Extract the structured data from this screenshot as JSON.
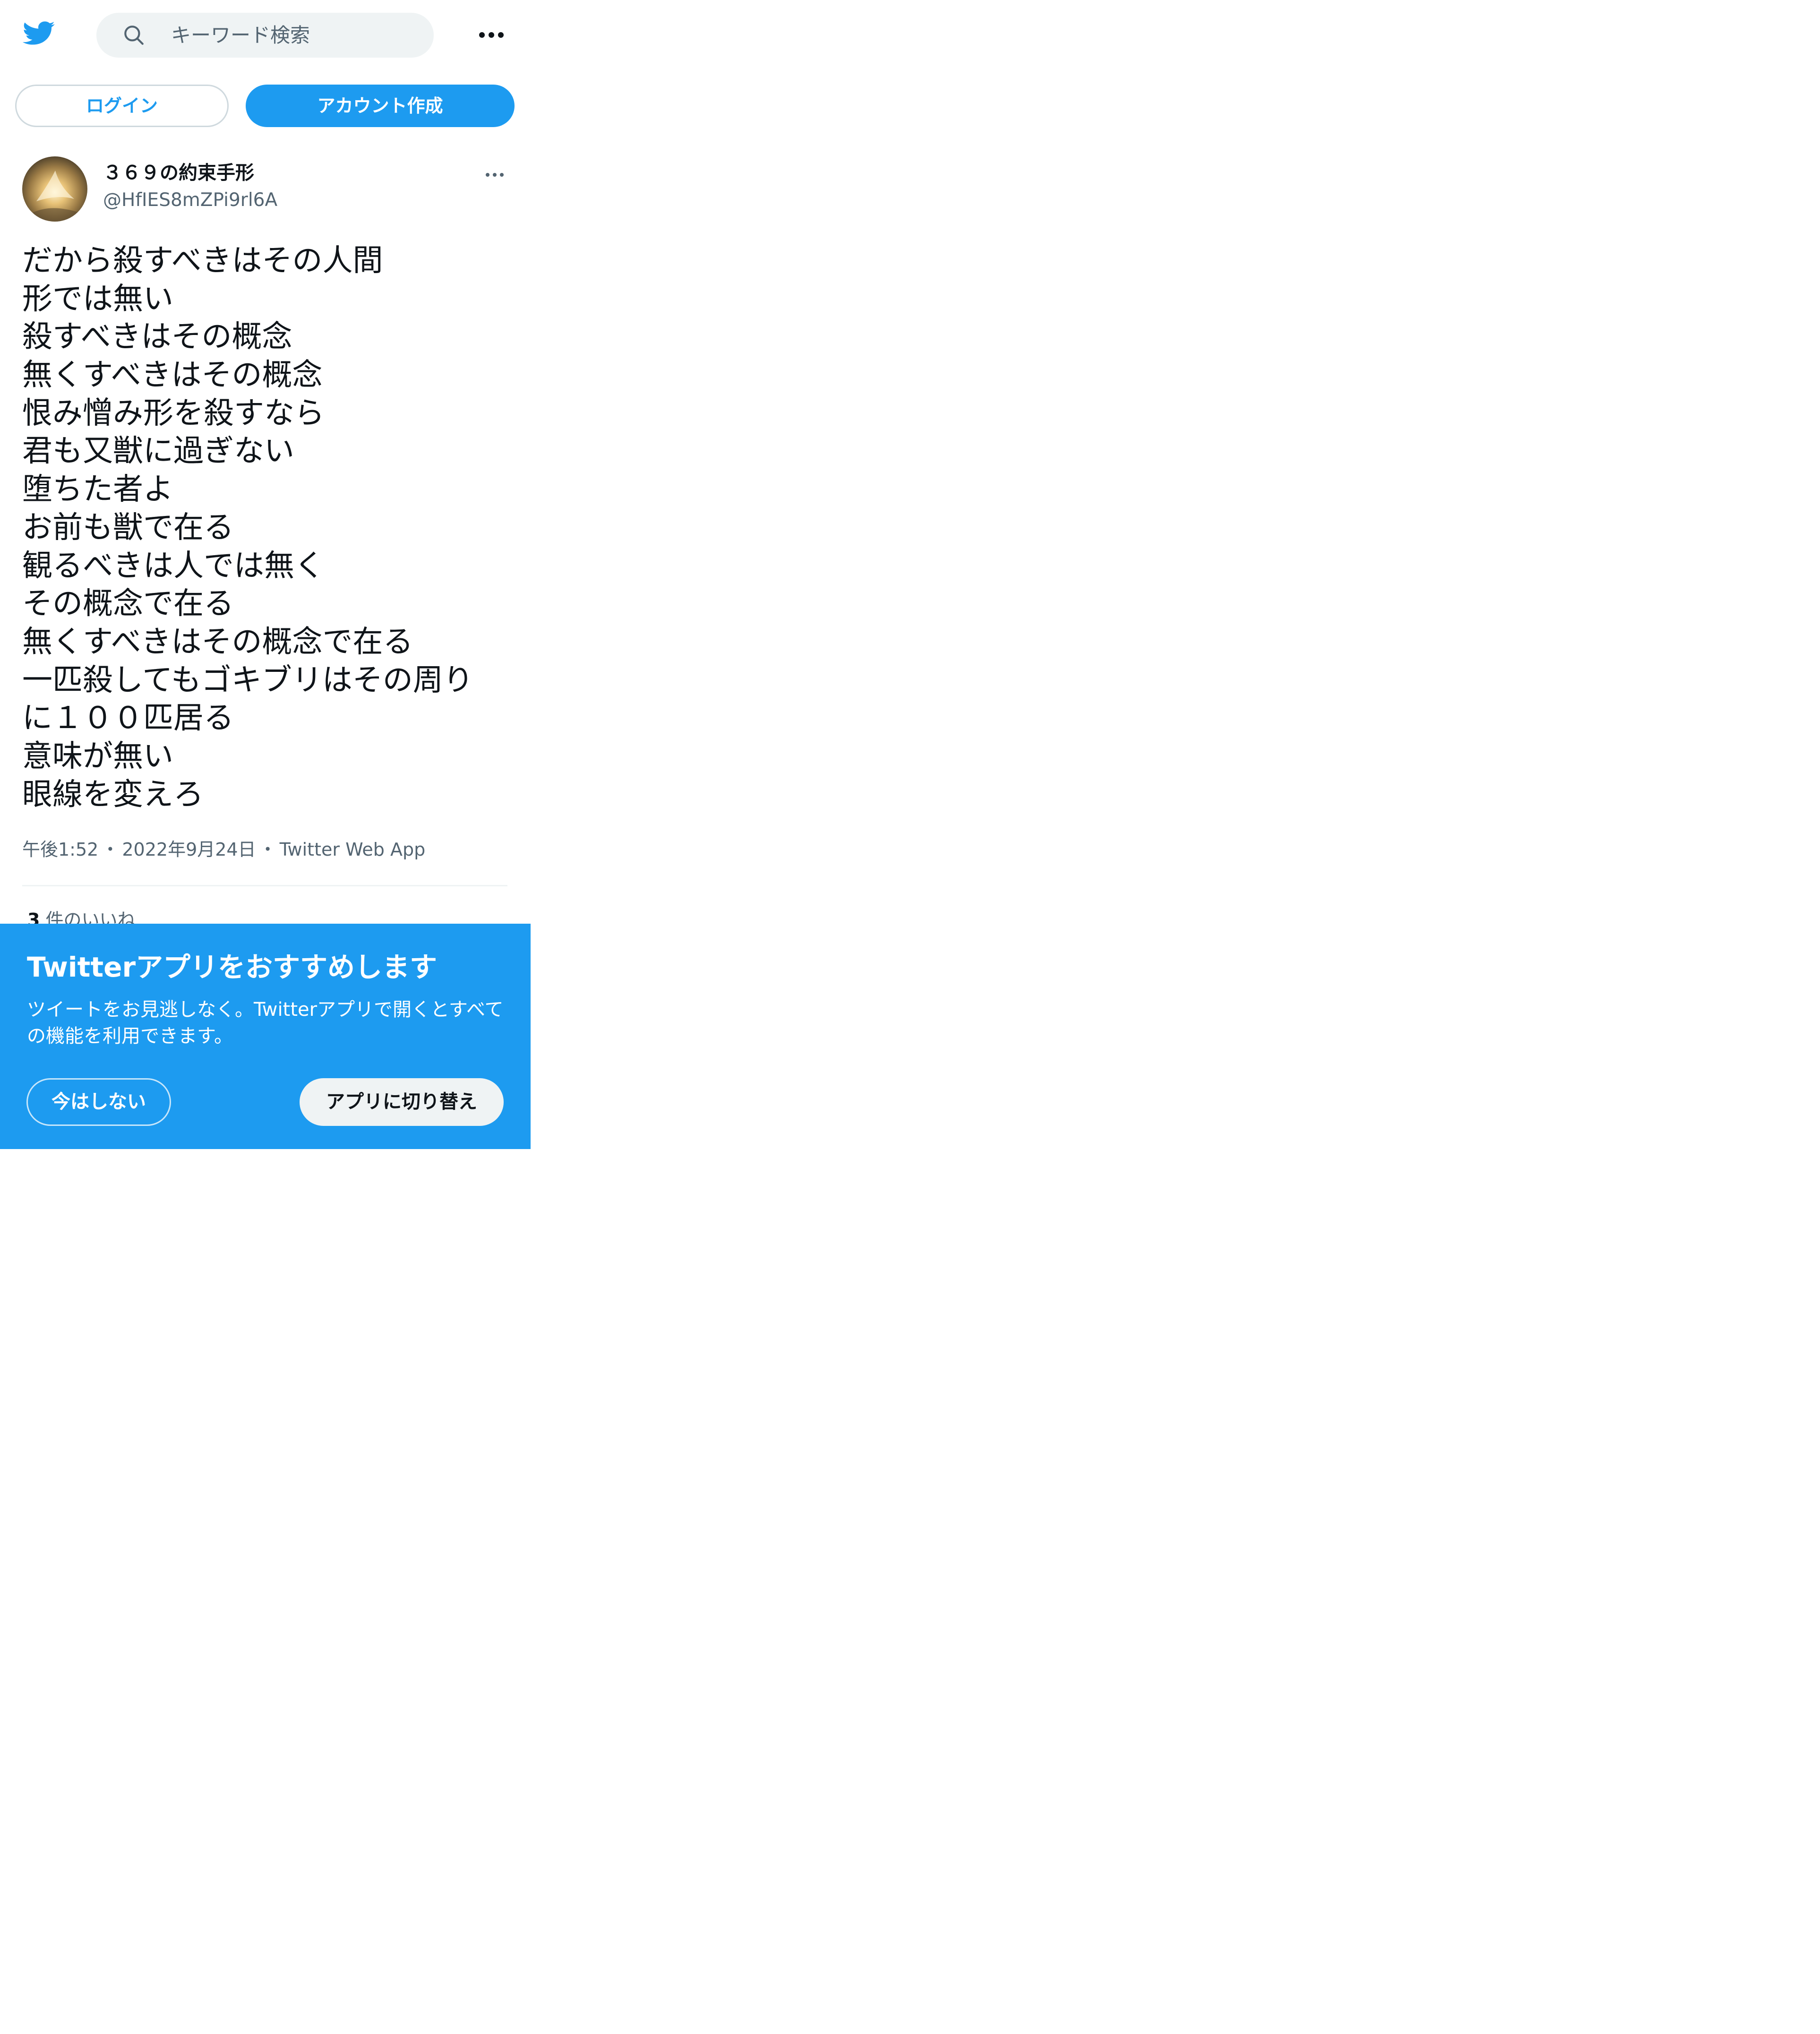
{
  "header": {
    "logo_icon": "twitter-bird-icon",
    "search_icon": "search-icon",
    "search_placeholder": "キーワード検索",
    "more_icon": "more-horizontal-icon"
  },
  "auth": {
    "login_label": "ログイン",
    "signup_label": "アカウント作成"
  },
  "tweet": {
    "author": {
      "display_name": "３６９の約束手形",
      "handle": "@HfIES8mZPi9rl6A"
    },
    "lines": [
      "だから殺すべきはその人間",
      "形では無い",
      "殺すべきはその概念",
      "無くすべきはその概念",
      "恨み憎み形を殺すなら",
      "君も又獣に過ぎない",
      "堕ちた者よ",
      "お前も獣で在る",
      "観るべきは人では無く",
      "その概念で在る",
      "無くすべきはその概念で在る",
      "一匹殺してもゴキブリはその周り",
      "に１００匹居る",
      "意味が無い",
      "眼線を変えろ"
    ],
    "time": "午後1:52",
    "date": "2022年9月24日",
    "source": "Twitter Web App",
    "separator": "・",
    "likes_count": "3",
    "likes_label": "件のいいね"
  },
  "banner": {
    "title": "Twitterアプリをおすすめします",
    "description": "ツイートをお見逃しなく。Twitterアプリで開くとすべての機能を利用できます。",
    "not_now_label": "今はしない",
    "switch_label": "アプリに切り替え"
  },
  "colors": {
    "brand_blue": "#1d9bf0",
    "text_primary": "#0f1419",
    "text_secondary": "#536471",
    "search_bg": "#eff3f4"
  }
}
